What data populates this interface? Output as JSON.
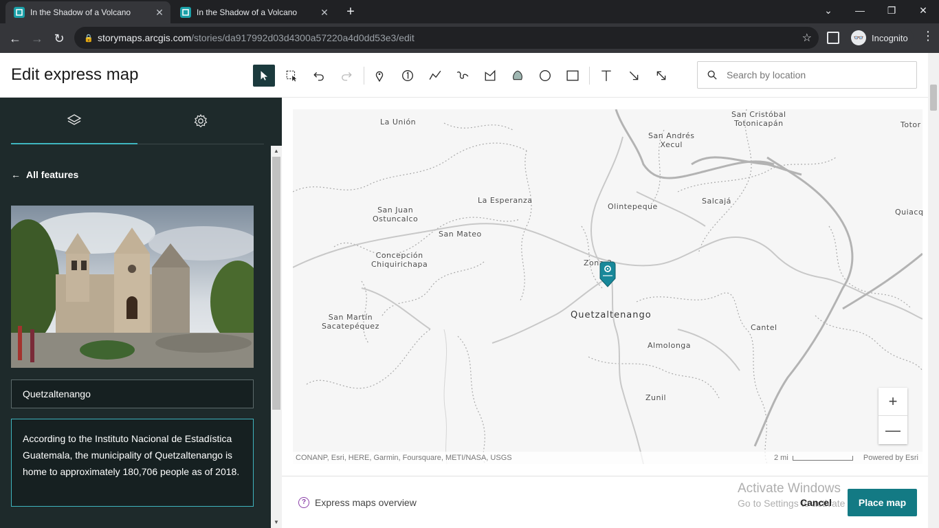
{
  "browser": {
    "tabs": [
      {
        "title": "In the Shadow of a Volcano",
        "active": true
      },
      {
        "title": "In the Shadow of a Volcano",
        "active": false
      }
    ],
    "new_tab": "+",
    "url_host": "storymaps.arcgis.com",
    "url_path": "/stories/da917992d03d4300a57220a4d0dd53e3/edit",
    "incognito_label": "Incognito"
  },
  "app": {
    "title": "Edit express map",
    "tools": [
      "select-tool",
      "marquee-select-tool",
      "undo-tool",
      "redo-tool",
      "pin-tool",
      "numbered-pin-tool",
      "line-tool",
      "path-tool",
      "polygon-tool",
      "freehand-area-tool",
      "circle-tool",
      "rectangle-tool",
      "text-tool",
      "arrow-tool",
      "double-arrow-tool"
    ],
    "search_placeholder": "Search by location"
  },
  "panel": {
    "back_label": "All features",
    "feature_name": "Quetzaltenango",
    "feature_description": "According to the Instituto Nacional de Estadística Guatemala, the municipality of Quetzaltenango is home to approximately 180,706 people as of 2018."
  },
  "map": {
    "labels": {
      "la_union": "La Unión",
      "san_cristobal": "San Cristóbal\nTotonicapán",
      "toto": "Totor",
      "san_andres": "San Andrés\nXecul",
      "san_juan": "San Juan\nOstuncalco",
      "la_esperanza": "La Esperanza",
      "olintepeque": "Olintepeque",
      "salcaja": "Salcajá",
      "quiaquix": "Quiacquix",
      "san_mateo": "San Mateo",
      "concepcion": "Concepción\nChiquirichapa",
      "zona": "Zona 3",
      "san_martin": "San Martín\nSacatepéquez",
      "quetzaltenango": "Quetzaltenango",
      "cantel": "Cantel",
      "almolonga": "Almolonga",
      "zunil": "Zunil"
    },
    "zoom_in": "+",
    "zoom_out": "—",
    "attribution": "CONANP, Esri, HERE, Garmin, Foursquare, METI/NASA, USGS",
    "scale_label": "2 mi",
    "powered_by": "Powered by Esri"
  },
  "footer": {
    "help_label": "Express maps overview",
    "cancel_label": "Cancel",
    "place_label": "Place map",
    "watermark_title": "Activate Windows",
    "watermark_sub": "Go to Settings to activate Windows."
  }
}
